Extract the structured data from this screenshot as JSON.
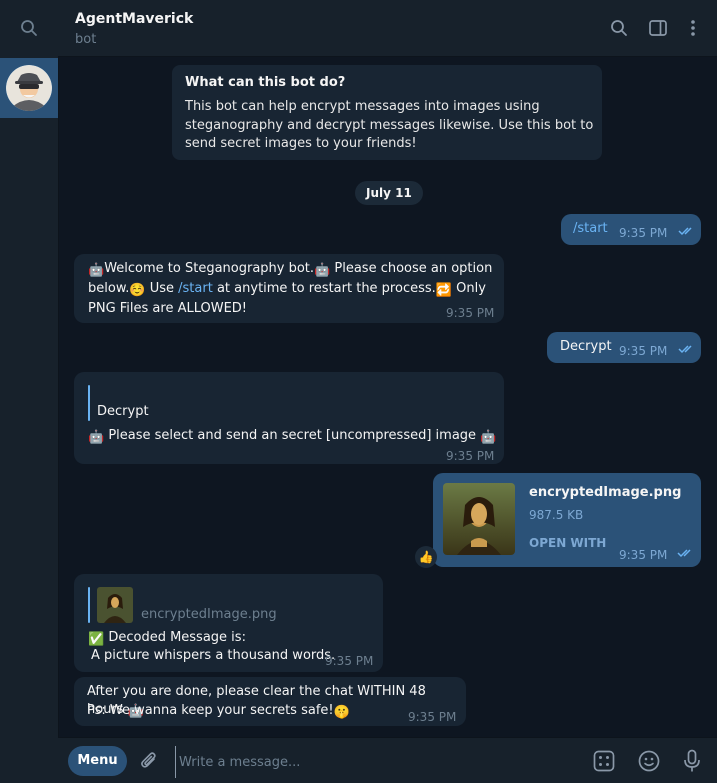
{
  "header": {
    "title": "AgentMaverick",
    "subtitle": "bot"
  },
  "intro": {
    "heading": "What can this bot do?",
    "text": "This bot can help encrypt messages into images using steganography and decrypt messages likewise. Use this bot to send secret images to your friends!"
  },
  "date_label": "July 11",
  "messages": {
    "m1": {
      "text": "/start",
      "time": "9:35 PM"
    },
    "m2": {
      "part1": "Welcome to Steganography bot.",
      "part2": "Please choose an option below.",
      "part3": "Use",
      "command": "/start",
      "part4": "at anytime to restart the process.",
      "part5": "Only PNG Files are ALLOWED!",
      "time": "9:35 PM"
    },
    "m3": {
      "text": "Decrypt",
      "time": "9:35 PM"
    },
    "m4": {
      "quote": "Decrypt",
      "text": "Please select and send an secret [uncompressed] image",
      "time": "9:35 PM"
    },
    "m5": {
      "file_name": "encryptedImage.png",
      "file_size": "987.5 KB",
      "open_with": "OPEN WITH",
      "time": "9:35 PM",
      "reaction": "👍"
    },
    "m6": {
      "reply_file": "encryptedImage.png",
      "line1": "Decoded Message is:",
      "line2": "A picture whispers a thousand words.",
      "time": "9:35 PM"
    },
    "m7": {
      "line1": "After you are done, please clear the chat WITHIN 48 hours",
      "line2": "Ps: We wanna keep your secrets safe!",
      "time": "9:35 PM"
    }
  },
  "composer": {
    "menu_label": "Menu",
    "placeholder": "Write a message..."
  },
  "icons": {
    "search": "search-icon",
    "sidebar": "sidebar-toggle-icon",
    "more": "more-vertical-icon",
    "attach": "paperclip-icon",
    "bot_commands": "bot-commands-icon",
    "emoji": "emoji-icon",
    "mic": "microphone-icon"
  },
  "colors": {
    "background": "#0e1621",
    "panel": "#17212b",
    "incoming": "#182533",
    "outgoing": "#2b5278",
    "accent": "#6ab3f3"
  }
}
